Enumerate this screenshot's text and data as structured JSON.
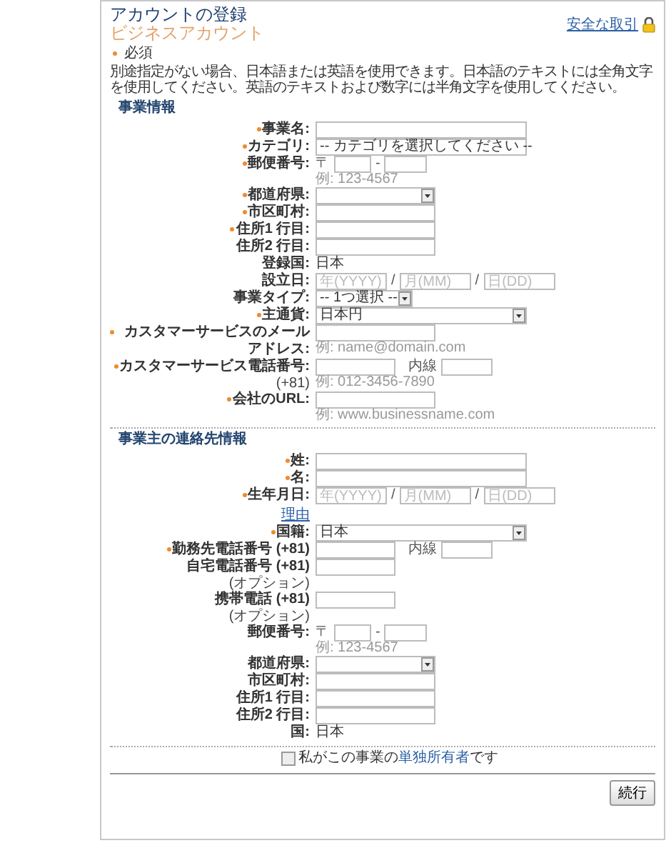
{
  "header": {
    "title": "アカウントの登録",
    "subtitle": "ビジネスアカウント",
    "secure_link": "安全な取引"
  },
  "required_legend": "必須",
  "notice": "別途指定がない場合、日本語または英語を使用できます。日本語のテキストには全角文字を使用してください。英語のテキストおよび数字には半角文字を使用してください。",
  "sections": [
    {
      "heading": "事業情報",
      "fields": [
        {
          "label": "事業名:",
          "required": true,
          "kind": "wide_text"
        },
        {
          "label": "カテゴリ:",
          "required": true,
          "kind": "wide_select",
          "value": "-- カテゴリを選択してください --"
        },
        {
          "label": "郵便番号:",
          "required": true,
          "kind": "postal",
          "prefix": "〒",
          "separator": "-",
          "hint": "例: 123-4567"
        },
        {
          "label": "都道府県:",
          "required": true,
          "kind": "select"
        },
        {
          "label": "市区町村:",
          "required": true,
          "kind": "text"
        },
        {
          "label": "住所1 行目:",
          "required": true,
          "kind": "text"
        },
        {
          "label": "住所2 行目:",
          "required": false,
          "kind": "text"
        },
        {
          "label": "登録国:",
          "required": false,
          "kind": "static",
          "value": "日本"
        },
        {
          "label": "設立日:",
          "required": false,
          "kind": "date",
          "placeholders": [
            "年(YYYY)",
            "月(MM)",
            "日(DD)"
          ],
          "separator": "/"
        },
        {
          "label": "事業タイプ:",
          "required": false,
          "kind": "short_select",
          "value": "-- 1つ選択 --"
        },
        {
          "label": "主通貨:",
          "required": true,
          "kind": "wide_select",
          "value": "日本円"
        },
        {
          "label": "カスタマーサービスのメールアドレス:",
          "required": true,
          "kind": "text",
          "hint": "例: name@domain.com"
        },
        {
          "label": "カスタマーサービス電話番号:",
          "note": "(+81)",
          "required": true,
          "kind": "phone",
          "extension": "内線",
          "hint": "例: 012-3456-7890"
        },
        {
          "label": "会社のURL:",
          "required": true,
          "kind": "text",
          "hint": "例: www.businessname.com"
        }
      ]
    },
    {
      "heading": "事業主の連絡先情報",
      "fields": [
        {
          "label": "姓:",
          "required": true,
          "kind": "wide_text"
        },
        {
          "label": "名:",
          "required": true,
          "kind": "wide_text"
        },
        {
          "label": "生年月日:",
          "link": "理由",
          "required": true,
          "kind": "date",
          "placeholders": [
            "年(YYYY)",
            "月(MM)",
            "日(DD)"
          ],
          "separator": "/"
        },
        {
          "label": "国籍:",
          "required": true,
          "kind": "wide_select",
          "value": "日本"
        },
        {
          "label": "勤務先電話番号 (+81)",
          "required": true,
          "kind": "phone",
          "extension": "内線"
        },
        {
          "label": "自宅電話番号 (+81)",
          "note": "(オプション)",
          "required": false,
          "kind": "short_text"
        },
        {
          "label": "携帯電話 (+81)",
          "note": "(オプション)",
          "required": false,
          "kind": "short_text"
        },
        {
          "label": "郵便番号:",
          "required": false,
          "kind": "postal",
          "prefix": "〒",
          "separator": "-",
          "hint": "例: 123-4567"
        },
        {
          "label": "都道府県:",
          "required": false,
          "kind": "select"
        },
        {
          "label": "市区町村:",
          "required": false,
          "kind": "text"
        },
        {
          "label": "住所1 行目:",
          "required": false,
          "kind": "text"
        },
        {
          "label": "住所2 行目:",
          "required": false,
          "kind": "text"
        },
        {
          "label": "国:",
          "required": false,
          "kind": "static",
          "value": "日本"
        }
      ]
    }
  ],
  "sole_owner": {
    "checked": false,
    "before": "私がこの事業の",
    "link": "単独所有者",
    "after": "です"
  },
  "continue_button": "続行"
}
